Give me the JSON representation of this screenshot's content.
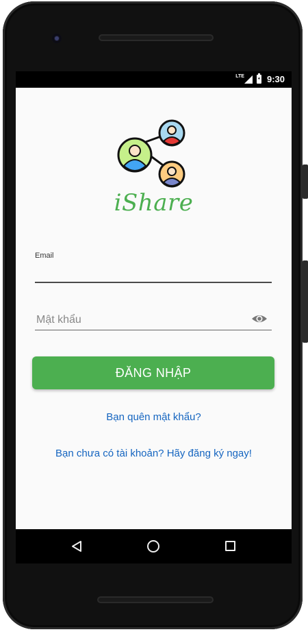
{
  "status_bar": {
    "network": "LTE",
    "time": "9:30"
  },
  "app": {
    "name": "iShare",
    "logo_icon": "people-network-icon"
  },
  "form": {
    "email_label": "Email",
    "email_value": "",
    "password_placeholder": "Mật khẩu",
    "password_value": "",
    "password_toggle_icon": "eye-icon",
    "login_button": "ĐĂNG NHẬP"
  },
  "links": {
    "forgot_password": "Bạn quên mật khẩu?",
    "signup": "Bạn chưa có tài khoản? Hãy đăng ký ngay!"
  },
  "nav_bar": {
    "back_icon": "back-triangle-icon",
    "home_icon": "home-circle-icon",
    "recents_icon": "recents-square-icon"
  },
  "colors": {
    "accent": "#4caf50",
    "link": "#1565c0",
    "background": "#fafafa"
  }
}
